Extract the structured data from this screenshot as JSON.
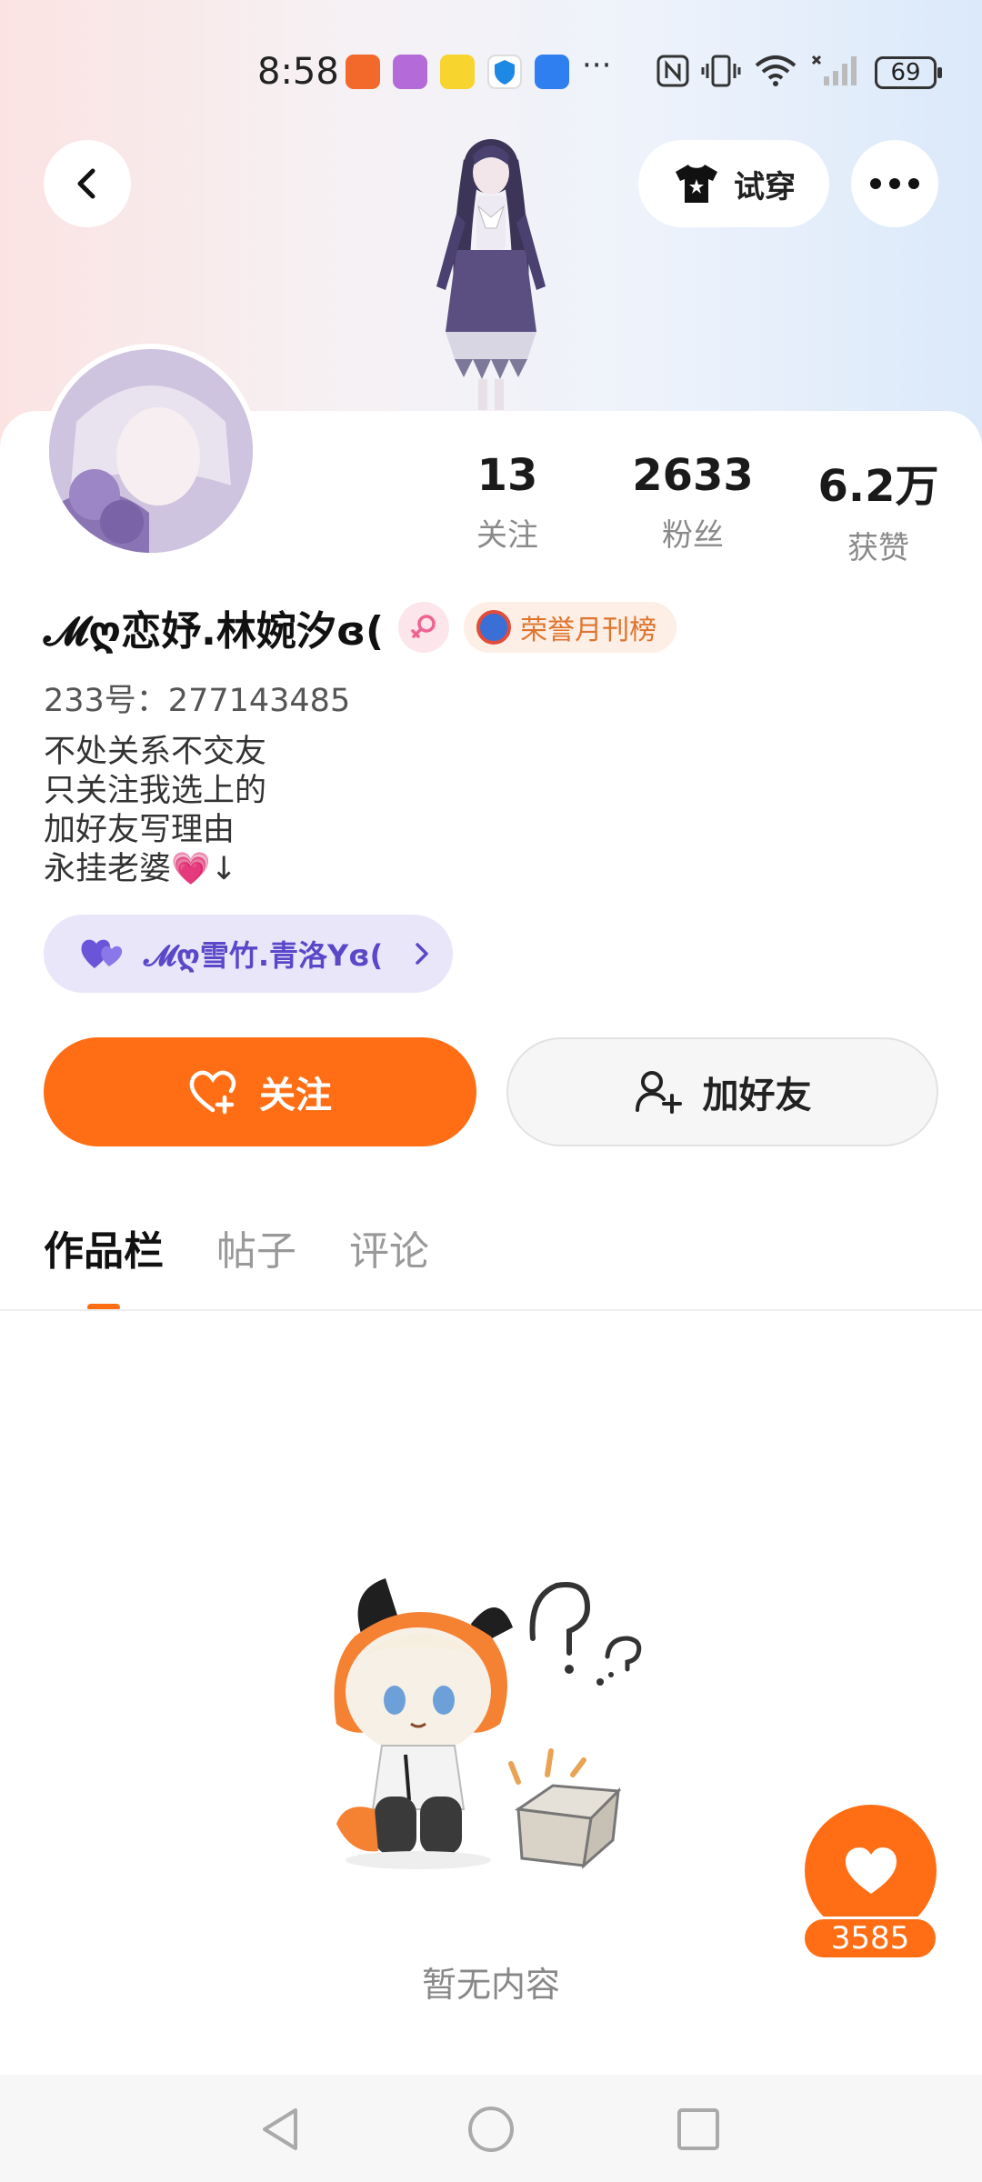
{
  "status_bar": {
    "time": "8:58",
    "battery": "69",
    "overflow": "···"
  },
  "header": {
    "tryon_label": "试穿"
  },
  "profile": {
    "stats": [
      {
        "value": "13",
        "label": "关注"
      },
      {
        "value": "2633",
        "label": "粉丝"
      },
      {
        "value": "6.2万",
        "label": "获赞"
      }
    ],
    "name": "𝓜ღ恋妤.林婉汐ɞ(",
    "honor_badge": "荣誉月刊榜",
    "uid": "233号：277143485",
    "bio": [
      "不处关系不交友",
      "只关注我选上的",
      "加好友写理由",
      "永挂老婆💗↓"
    ],
    "couple_link": "𝓜ღ雪竹.青洛Yɞ("
  },
  "actions": {
    "follow_label": "关注",
    "add_friend_label": "加好友"
  },
  "tabs": [
    {
      "label": "作品栏",
      "active": true
    },
    {
      "label": "帖子",
      "active": false
    },
    {
      "label": "评论",
      "active": false
    }
  ],
  "empty_state": {
    "text": "暂无内容"
  },
  "like_button": {
    "count": "3585"
  },
  "colors": {
    "accent": "#ff6e14",
    "couple_bg": "#e9e6fa",
    "couple_text": "#5a48c9",
    "honor_text": "#e0742c"
  }
}
